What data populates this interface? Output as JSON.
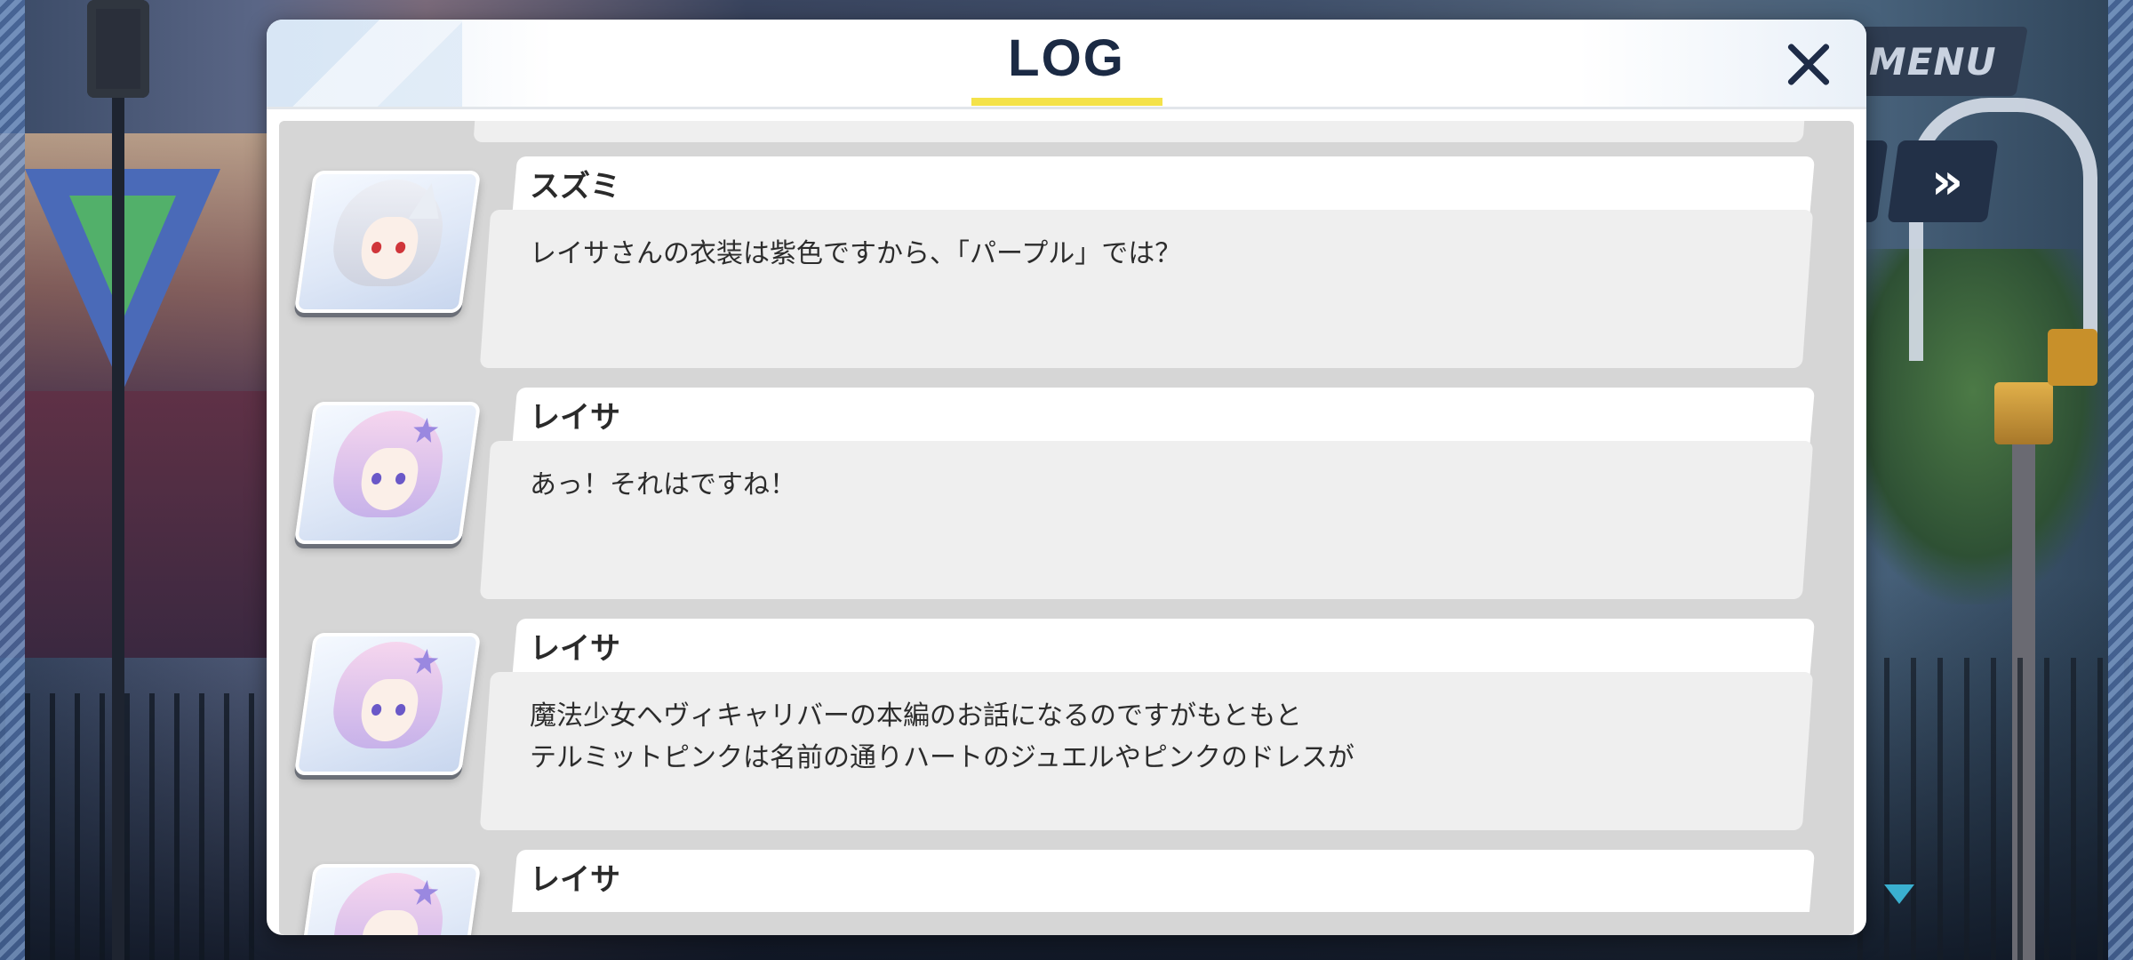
{
  "background": {
    "menu_label": "MENU",
    "skip_symbol": "»"
  },
  "dialog": {
    "title": "LOG",
    "close_symbol": "close"
  },
  "entries": [
    {
      "speaker": "スズミ",
      "avatar": "suzumi-portrait",
      "text": "レイサさんの衣装は紫色ですから、「パープル」では？"
    },
    {
      "speaker": "レイサ",
      "avatar": "reisa-portrait",
      "text": "あっ！それはですね！"
    },
    {
      "speaker": "レイサ",
      "avatar": "reisa-portrait",
      "text": "魔法少女ヘヴィキャリバーの本編のお話になるのですがもともと\nテルミットピンクは名前の通りハートのジュエルやピンクのドレスが"
    },
    {
      "speaker": "レイサ",
      "avatar": "reisa-portrait",
      "text": ""
    }
  ],
  "colors": {
    "title": "#1b2a44",
    "title_underline": "#f4e24a",
    "log_background": "#d6d6d6",
    "bubble": "#efefef",
    "next_indicator": "#3ab0d0"
  }
}
